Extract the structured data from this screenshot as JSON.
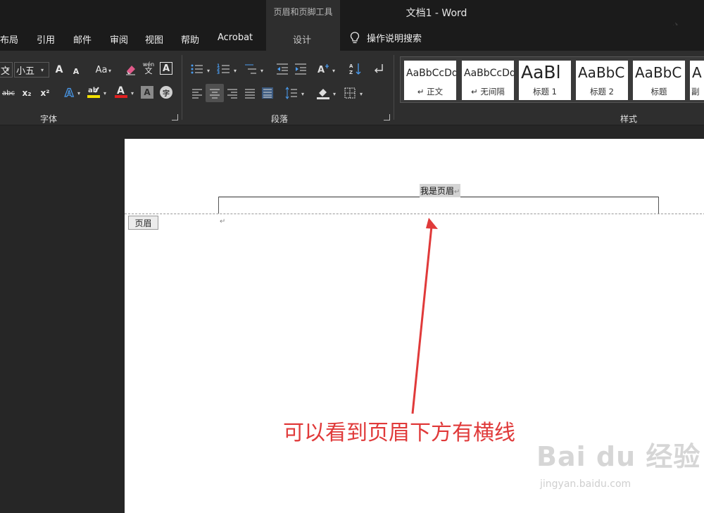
{
  "window": {
    "title": "文档1  -  Word",
    "context_tool": "页眉和页脚工具"
  },
  "menu": {
    "tabs": [
      "布局",
      "引用",
      "邮件",
      "审阅",
      "视图",
      "帮助",
      "Acrobat"
    ],
    "design_tab": "设计",
    "search": "操作说明搜索"
  },
  "ribbon": {
    "font": {
      "label": "字体",
      "font_name": "文",
      "font_size": "小五",
      "case_button": "Aa",
      "grow_font": "A",
      "shrink_font": "A",
      "strike": "abc",
      "subscript": "x₂",
      "superscript": "x²",
      "phonetic": "wén",
      "char_border": "A",
      "char_shading": "A",
      "enclose": "字"
    },
    "paragraph": {
      "label": "段落"
    },
    "styles": {
      "label": "样式",
      "items": [
        {
          "sample": "AaBbCcDd",
          "name": "↵ 正文"
        },
        {
          "sample": "AaBbCcDd",
          "name": "↵ 无间隔"
        },
        {
          "sample": "AaBl",
          "name": "标题 1"
        },
        {
          "sample": "AaBbC",
          "name": "标题 2"
        },
        {
          "sample": "AaBbC",
          "name": "标题"
        },
        {
          "sample": "A",
          "name": "副"
        }
      ]
    }
  },
  "document": {
    "header_text": "我是页眉",
    "paragraph_mark": "↵",
    "header_tag": "页眉",
    "annotation": "可以看到页眉下方有横线",
    "watermark": "Bai du 经验",
    "watermark_url": "jingyan.baidu.com"
  },
  "colors": {
    "titlebar": "#1b1b1b",
    "ribbon": "#2e2e2e",
    "annotation": "#e03a3a",
    "highlight_yellow": "#f2e000",
    "font_red": "#e02020"
  },
  "icons": [
    "lightbulb-icon",
    "bullets-icon",
    "numbering-icon",
    "multilevel-list-icon",
    "decrease-indent-icon",
    "increase-indent-icon",
    "sort-icon",
    "show-marks-icon",
    "align-left-icon",
    "align-center-icon",
    "align-right-icon",
    "justify-icon",
    "distributed-icon",
    "line-spacing-icon",
    "shading-icon",
    "borders-icon",
    "eraser-icon",
    "text-effects-icon",
    "highlighter-icon",
    "font-color-icon"
  ]
}
